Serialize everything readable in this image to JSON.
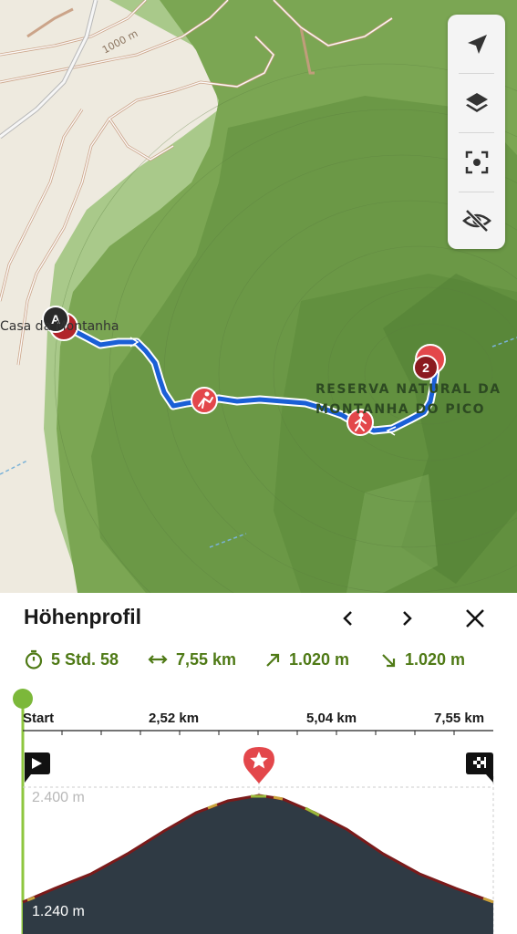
{
  "map": {
    "place_label": "Casa da Montanha",
    "reserve_label_line1": "RESERVA NATURAL DA",
    "reserve_label_line2": "MONTANHA DO PICO",
    "contour_label": "1000 m",
    "start_marker": "A",
    "end_marker": "2",
    "controls": [
      {
        "name": "locate-icon"
      },
      {
        "name": "layers-icon"
      },
      {
        "name": "focus-icon"
      },
      {
        "name": "hide-icon"
      }
    ],
    "colors": {
      "route": "#1a5fd6",
      "forest": "#6f9e48",
      "poi": "#e3474b"
    }
  },
  "panel": {
    "title": "Höhenprofil",
    "stats": {
      "duration": "5 Std. 58",
      "distance": "7,55 km",
      "ascent": "1.020 m",
      "descent": "1.020 m"
    },
    "accent_color": "#4f7a16"
  },
  "profile": {
    "x_ticks": [
      "Start",
      "2,52 km",
      "5,04 km",
      "7,55 km"
    ],
    "elevation_max_label": "2.400 m",
    "elevation_min_label": "1.240 m",
    "markers": [
      "start-flag-icon",
      "summit-star-icon",
      "finish-flag-icon"
    ]
  }
}
